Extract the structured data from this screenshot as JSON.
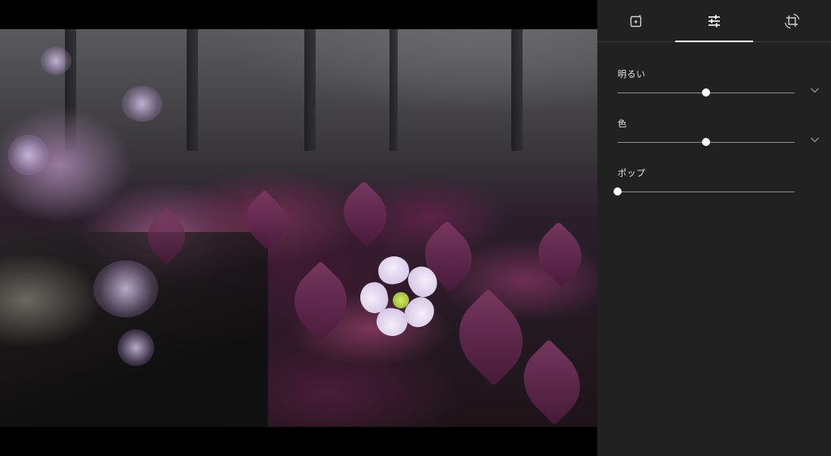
{
  "tabs": [
    {
      "id": "auto-enhance",
      "icon": "auto-enhance-icon",
      "selected": false
    },
    {
      "id": "adjust",
      "icon": "tune-sliders-icon",
      "selected": true
    },
    {
      "id": "crop-rotate",
      "icon": "crop-rotate-icon",
      "selected": false
    }
  ],
  "adjustments": {
    "brightness": {
      "label": "明るい",
      "value": 0.5,
      "expandable": true
    },
    "color": {
      "label": "色",
      "value": 0.5,
      "expandable": true
    },
    "pop": {
      "label": "ポップ",
      "value": 0.0,
      "expandable": false
    }
  },
  "colors": {
    "panel_bg": "#212121",
    "accent": "#ffffff",
    "track": "#8c8c8c"
  }
}
